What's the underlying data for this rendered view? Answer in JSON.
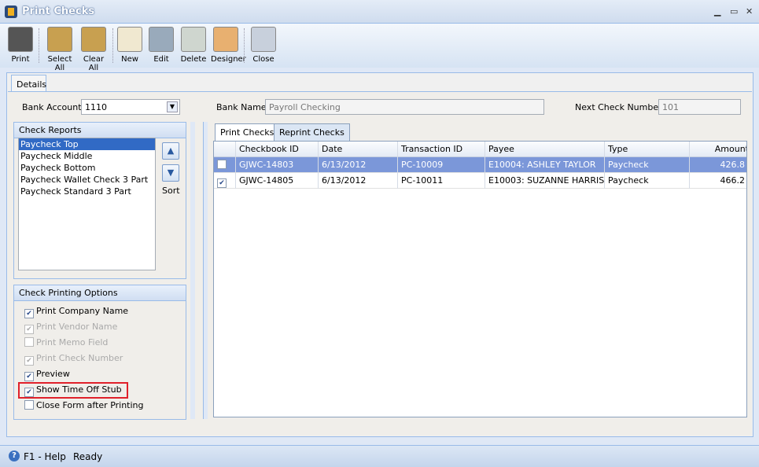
{
  "window": {
    "title": "Print Checks",
    "minimize": "▁",
    "maximize": "▭",
    "close": "✕"
  },
  "toolbar": [
    {
      "label": "Print",
      "icon": "printer-icon",
      "color": "#555"
    },
    {
      "label": "Select All",
      "icon": "select-all-icon",
      "color": "#c8a050"
    },
    {
      "label": "Clear All",
      "icon": "clear-all-icon",
      "color": "#c8a050"
    },
    {
      "label": "New",
      "icon": "new-document-icon",
      "color": "#f0e8d0"
    },
    {
      "label": "Edit",
      "icon": "wrench-icon",
      "color": "#9ab"
    },
    {
      "label": "Delete",
      "icon": "recycle-bin-icon",
      "color": "#cfd6cf"
    },
    {
      "label": "Designer",
      "icon": "designer-icon",
      "color": "#e8b070"
    },
    {
      "label": "Close",
      "icon": "close-window-icon",
      "color": "#c8d0dc"
    }
  ],
  "tab": "Details",
  "form": {
    "bank_account_label": "Bank Account",
    "bank_account": "1110",
    "bank_name_label": "Bank Name",
    "bank_name": "Payroll Checking",
    "next_check_label": "Next Check Number",
    "next_check": "101"
  },
  "check_reports": {
    "title": "Check Reports",
    "items": [
      "Paycheck Top",
      "Paycheck Middle",
      "Paycheck Bottom",
      "Paycheck Wallet Check 3 Part",
      "Paycheck Standard 3 Part"
    ],
    "selected": 0,
    "sort_label": "Sort"
  },
  "options": {
    "title": "Check Printing Options",
    "items": [
      {
        "label": "Print Company Name",
        "checked": true,
        "enabled": true
      },
      {
        "label": "Print Vendor Name",
        "checked": true,
        "enabled": false
      },
      {
        "label": "Print Memo Field",
        "checked": false,
        "enabled": false
      },
      {
        "label": "Print Check Number",
        "checked": true,
        "enabled": false
      },
      {
        "label": "Preview",
        "checked": true,
        "enabled": true
      },
      {
        "label": "Show Time Off Stub",
        "checked": true,
        "enabled": true,
        "highlighted": true
      },
      {
        "label": "Close Form after Printing",
        "checked": false,
        "enabled": true
      }
    ]
  },
  "check_tabs": [
    "Print Checks",
    "Reprint Checks"
  ],
  "grid": {
    "columns": [
      "Checkbook ID",
      "Date",
      "Transaction ID",
      "Payee",
      "Type",
      "Amount"
    ],
    "rows": [
      {
        "checked": false,
        "selected": true,
        "cells": [
          "GJWC-14803",
          "6/13/2012",
          "PC-10009",
          "E10004: ASHLEY TAYLOR",
          "Paycheck",
          "426.8"
        ]
      },
      {
        "checked": true,
        "selected": false,
        "cells": [
          "GJWC-14805",
          "6/13/2012",
          "PC-10011",
          "E10003: SUZANNE HARRIS",
          "Paycheck",
          "466.2"
        ]
      }
    ]
  },
  "status": {
    "help": "F1 - Help",
    "state": "Ready"
  }
}
